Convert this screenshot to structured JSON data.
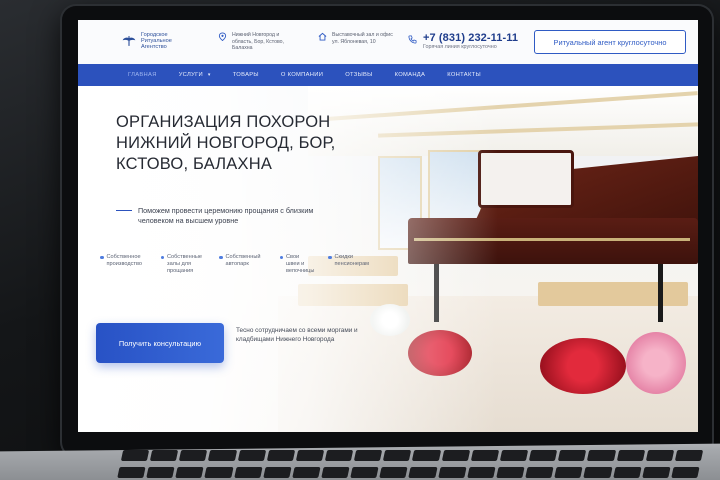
{
  "logo": {
    "text": "Городское Ритуальное Агентство",
    "mark_color": "#2c4f9a"
  },
  "header": {
    "address": "Нижний Новгород и область, Бор, Кстово, Балахна",
    "showroom": "Выставочный зал и офис ул. Яблоневая, 10",
    "phone": "+7 (831) 232-11-11",
    "phone_note": "Горячая линия круглосуточно",
    "agent_button": "Ритуальный агент круглосуточно",
    "icons": [
      "location-pin-icon",
      "home-icon",
      "phone-icon"
    ]
  },
  "nav": {
    "items": [
      {
        "label": "ГЛАВНАЯ",
        "active": true
      },
      {
        "label": "УСЛУГИ"
      },
      {
        "label": "ТОВАРЫ"
      },
      {
        "label": "О КОМПАНИИ"
      },
      {
        "label": "ОТЗЫВЫ"
      },
      {
        "label": "КОМАНДА"
      },
      {
        "label": "КОНТАКТЫ"
      }
    ],
    "services_chevron": "chevron-down-icon",
    "bg_color": "#2c52bd"
  },
  "hero": {
    "title": "ОРГАНИЗАЦИЯ ПОХОРОН\nНИЖНИЙ НОВГОРОД, БОР,\nКСТОВО, БАЛАХНА",
    "lead": "Поможем провести церемонию прощания с близким человеком на высшем уровне",
    "features": [
      "Собственное производство",
      "Собственные залы для прощания",
      "Собственный автопарк",
      "Свои швеи и вепочницы",
      "Скидки пенсионерам"
    ],
    "cta": "Получить консультацию",
    "note": "Тесно сотрудничаем со всеми моргами и кладбищами Нижнего Новгорода"
  },
  "colors": {
    "accent": "#2c52bd",
    "title": "#262a33",
    "phone": "#1f3d8c"
  }
}
